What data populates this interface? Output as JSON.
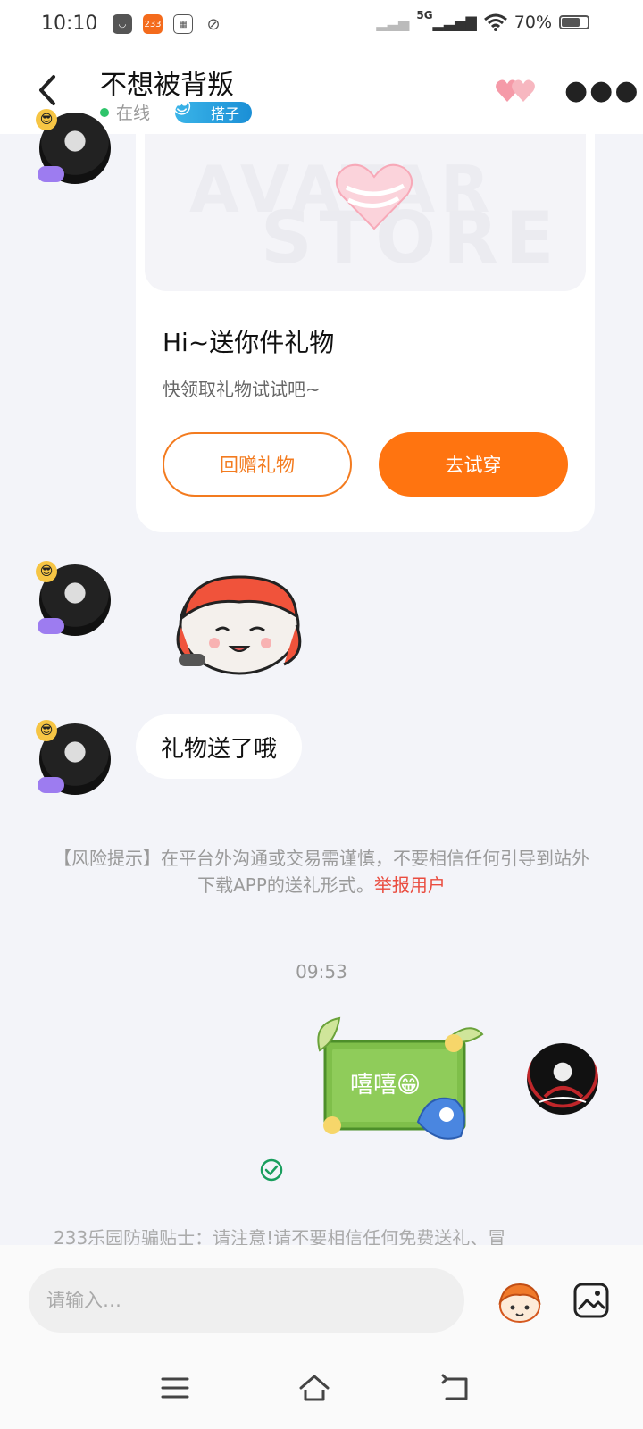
{
  "status_bar": {
    "time": "10:10",
    "app_badge_233": "233",
    "network": "5G",
    "battery": "70%",
    "battery_fraction": 0.7
  },
  "header": {
    "title": "不想被背叛",
    "online_label": "在线",
    "tag_label": "搭子"
  },
  "gift_card": {
    "watermark_line1": "AVATAR",
    "watermark_line2": "STORE",
    "title": "Hi~送你件礼物",
    "subtitle": "快领取礼物试试吧~",
    "return_gift_button": "回赠礼物",
    "try_on_button": "去试穿"
  },
  "messages": {
    "gift_sent_text": "礼物送了哦",
    "my_sticker_text": "嘻嘻😁"
  },
  "risk_notice": {
    "text": "【风险提示】在平台外沟通或交易需谨慎，不要相信任何引导到站外下载APP的送礼形式。",
    "report_link": "举报用户"
  },
  "timestamp": "09:53",
  "anti_fraud_tip": "233乐园防骗贴士：请注意!请不要相信任何免费送礼、冒",
  "input": {
    "placeholder": "请输入…"
  },
  "icons": {
    "back": "back-arrow-icon",
    "more": "more-dots-icon",
    "hearts": "hearts-icon",
    "emoji": "emoji-face-icon",
    "image": "image-picker-icon",
    "sent_status": "check-circle-icon"
  },
  "colors": {
    "accent_orange": "#ff7410",
    "online_green": "#2ec46a",
    "report_red": "#ea4c3f",
    "tag_blue": "#1b8fd6"
  }
}
